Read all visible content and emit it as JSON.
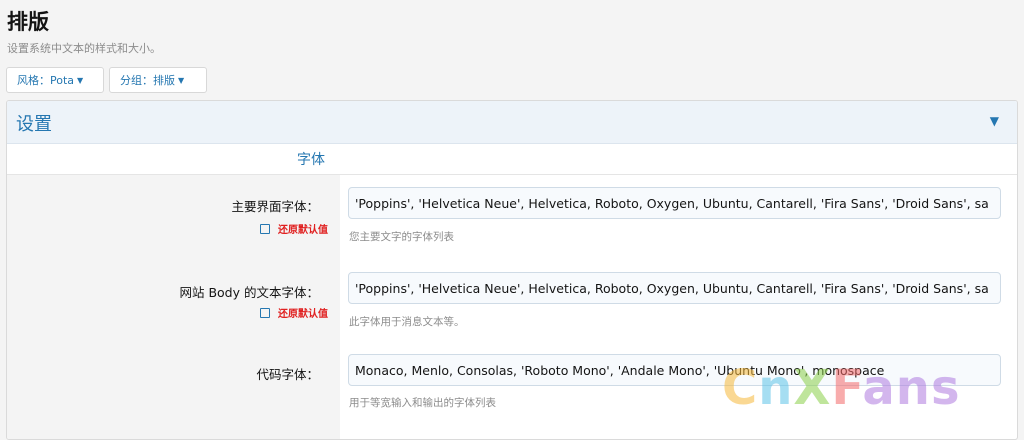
{
  "page": {
    "title": "排版",
    "description": "设置系统中文本的样式和大小。"
  },
  "toolbar": {
    "style_label": "风格：",
    "style_value": "Pota",
    "group_label": "分组：",
    "group_value": "排版"
  },
  "panel": {
    "title": "设置",
    "section_title": "字体",
    "revert_label": "还原默认值",
    "rows": [
      {
        "label": "主要界面字体：",
        "value": "'Poppins', 'Helvetica Neue', Helvetica, Roboto, Oxygen, Ubuntu, Cantarell, 'Fira Sans', 'Droid Sans', sa",
        "hint": "您主要文字的字体列表"
      },
      {
        "label": "网站 Body 的文本字体：",
        "value": "'Poppins', 'Helvetica Neue', Helvetica, Roboto, Oxygen, Ubuntu, Cantarell, 'Fira Sans', 'Droid Sans', sa",
        "hint": "此字体用于消息文本等。"
      },
      {
        "label": "代码字体：",
        "value": "Monaco, Menlo, Consolas, 'Roboto Mono', 'Andale Mono', 'Ubuntu Mono', monospace",
        "hint": "用于等宽输入和输出的字体列表"
      }
    ]
  },
  "watermark": {
    "parts": [
      "C",
      "n",
      "X",
      "F",
      "ans"
    ]
  },
  "colors": {
    "accent": "#2577b1",
    "revert": "#e02020",
    "page_bg": "#f4f4f4"
  }
}
